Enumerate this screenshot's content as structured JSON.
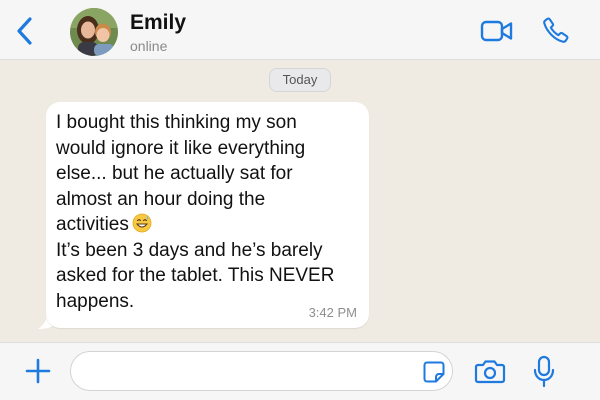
{
  "header": {
    "contact_name": "Emily",
    "status": "online",
    "back_icon": "chevron-left-icon",
    "video_icon": "video-camera-icon",
    "call_icon": "phone-icon"
  },
  "chat": {
    "date_label": "Today",
    "messages": [
      {
        "text": "I bought this thinking my son\nwould ignore it like everything\nelse... but he actually sat for\nalmost an hour doing the\nactivities",
        "emoji": "grinning-sweat-emoji",
        "text_after_emoji": "It’s been 3 days and he’s barely\nasked for the tablet. This NEVER\nhappens.",
        "time": "3:42 PM",
        "direction": "incoming"
      }
    ]
  },
  "composer": {
    "placeholder": "",
    "value": "",
    "plus_icon": "plus-icon",
    "sticker_icon": "sticker-icon",
    "camera_icon": "camera-icon",
    "mic_icon": "microphone-icon"
  },
  "colors": {
    "accent": "#1f7ae0",
    "chat_background": "#efeae2",
    "bar_background": "#f6f6f6",
    "bubble": "#ffffff"
  }
}
